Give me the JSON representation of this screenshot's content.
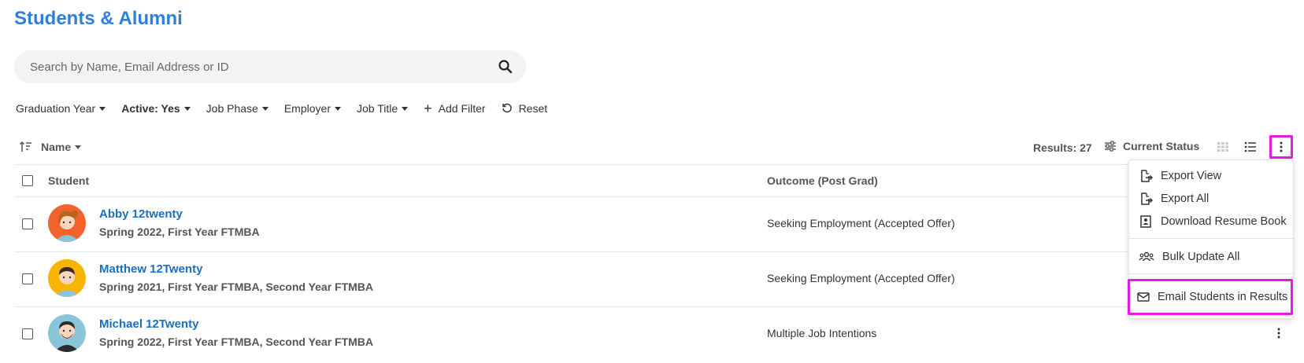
{
  "header": {
    "title": "Students & Alumni"
  },
  "search": {
    "placeholder": "Search by Name, Email Address or ID",
    "value": ""
  },
  "filters": {
    "items": [
      {
        "label": "Graduation Year"
      },
      {
        "label": "Active: Yes"
      },
      {
        "label": "Job Phase"
      },
      {
        "label": "Employer"
      },
      {
        "label": "Job Title"
      }
    ],
    "add_filter": "Add Filter",
    "reset": "Reset"
  },
  "toolbar": {
    "sort_label": "Name",
    "results": "Results: 27",
    "status_label": "Current Status"
  },
  "table": {
    "columns": {
      "student": "Student",
      "outcome": "Outcome (Post Grad)"
    },
    "rows": [
      {
        "name": "Abby 12twenty",
        "details": "Spring 2022, First Year FTMBA",
        "outcome": "Seeking Employment (Accepted Offer)",
        "avatar_bg": "#f2622c",
        "hair": "#b5651d",
        "avatar_icon": "female-avatar-icon"
      },
      {
        "name": "Matthew 12Twenty",
        "details": "Spring 2021, First Year FTMBA, Second Year FTMBA",
        "outcome": "Seeking Employment (Accepted Offer)",
        "avatar_bg": "#f7b500",
        "hair": "#3a2a1f",
        "avatar_icon": "male-avatar-icon"
      },
      {
        "name": "Michael 12Twenty",
        "details": "Spring 2022, First Year FTMBA, Second Year FTMBA",
        "outcome": "Multiple Job Intentions",
        "avatar_bg": "#8ac4d8",
        "hair": "#2b2b2b",
        "avatar_icon": "bearded-avatar-icon"
      }
    ]
  },
  "menu": {
    "items": [
      {
        "label": "Export View",
        "icon": "export-icon"
      },
      {
        "label": "Export All",
        "icon": "export-icon"
      },
      {
        "label": "Download Resume Book",
        "icon": "resume-book-icon"
      },
      {
        "label": "Bulk Update All",
        "icon": "users-icon"
      },
      {
        "label": "Email Students in Results",
        "icon": "envelope-icon"
      }
    ]
  },
  "colors": {
    "accent": "#2f7fd8",
    "link": "#1a6fbf",
    "highlight": "#e31be3"
  }
}
